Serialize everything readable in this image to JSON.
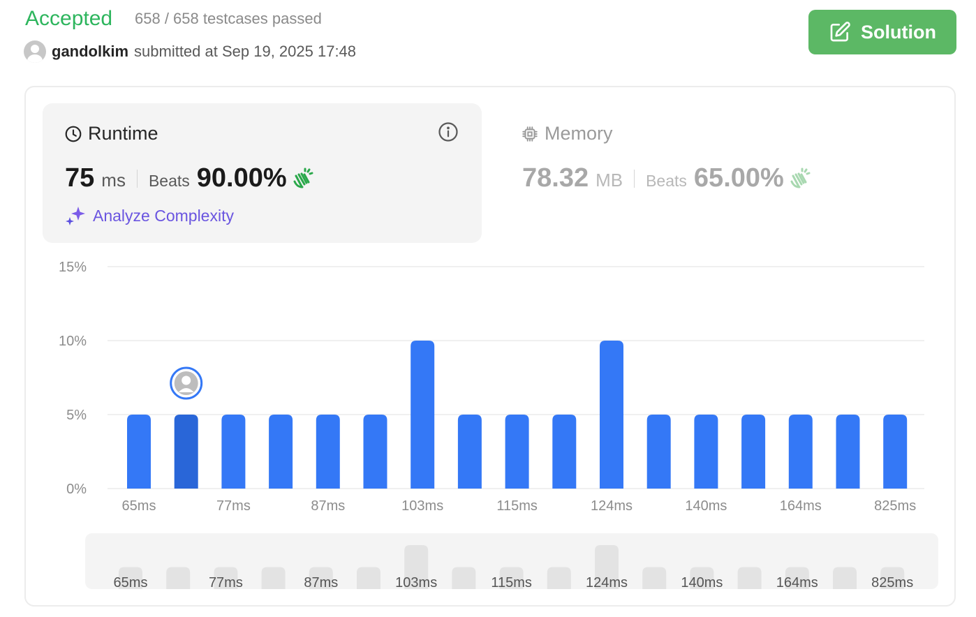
{
  "status": {
    "title": "Accepted",
    "testcases": "658 / 658 testcases passed"
  },
  "submission": {
    "username": "gandolkim",
    "submitted_text": "submitted at Sep 19, 2025 17:48"
  },
  "solution_button": {
    "label": "Solution"
  },
  "runtime": {
    "title": "Runtime",
    "value": "75",
    "unit": "ms",
    "beats_label": "Beats",
    "beats_value": "90.00%",
    "analyze_label": "Analyze Complexity"
  },
  "memory": {
    "title": "Memory",
    "value": "78.32",
    "unit": "MB",
    "beats_label": "Beats",
    "beats_value": "65.00%"
  },
  "colors": {
    "accepted": "#2db55d",
    "solution_button": "#5cb865",
    "bar": "#3478f6",
    "bar_selected": "#2966d8",
    "analyze": "#6a55e0",
    "minimap_bar": "#e3e3e3"
  },
  "chart_data": {
    "type": "bar",
    "categories": [
      "65ms",
      "",
      "77ms",
      "",
      "87ms",
      "",
      "103ms",
      "",
      "115ms",
      "",
      "124ms",
      "",
      "140ms",
      "",
      "164ms",
      "",
      "825ms"
    ],
    "values": [
      5,
      5,
      5,
      5,
      5,
      5,
      10,
      5,
      5,
      5,
      10,
      5,
      5,
      5,
      5,
      5,
      5
    ],
    "yticks": [
      "0%",
      "5%",
      "10%",
      "15%"
    ],
    "ylim": [
      0,
      15
    ],
    "grid": true,
    "selected_index": 1
  }
}
